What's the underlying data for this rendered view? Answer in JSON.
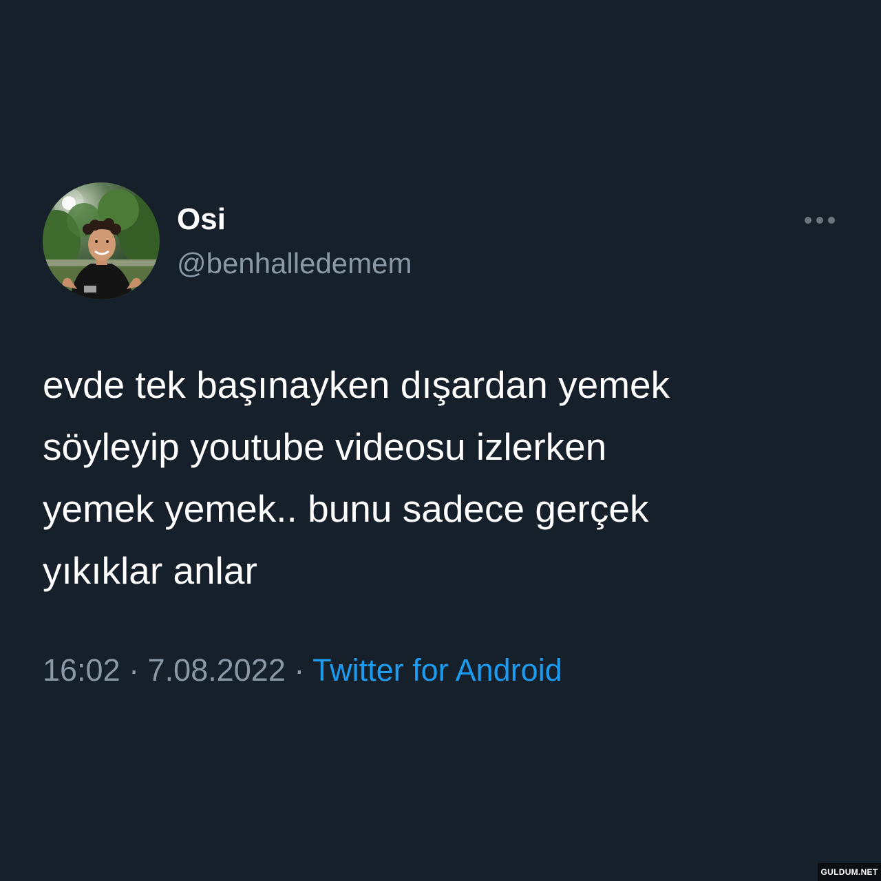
{
  "tweet": {
    "display_name": "Osi",
    "handle": "@benhalledemem",
    "text": "evde tek başınayken dışardan yemek\nsöyleyip youtube videosu izlerken\nyemek yemek.. bunu sadece gerçek\nyıkıklar anlar",
    "time": "16:02",
    "date": "7.08.2022",
    "separator": "·",
    "source": "Twitter for Android",
    "more_icon": "more-horizontal-icon",
    "avatar_icon": "profile-photo"
  },
  "colors": {
    "background": "#15202b",
    "text_primary": "#ffffff",
    "text_secondary": "#8b98a5",
    "link": "#1d9bf0"
  },
  "watermark": "GULDUM.NET"
}
